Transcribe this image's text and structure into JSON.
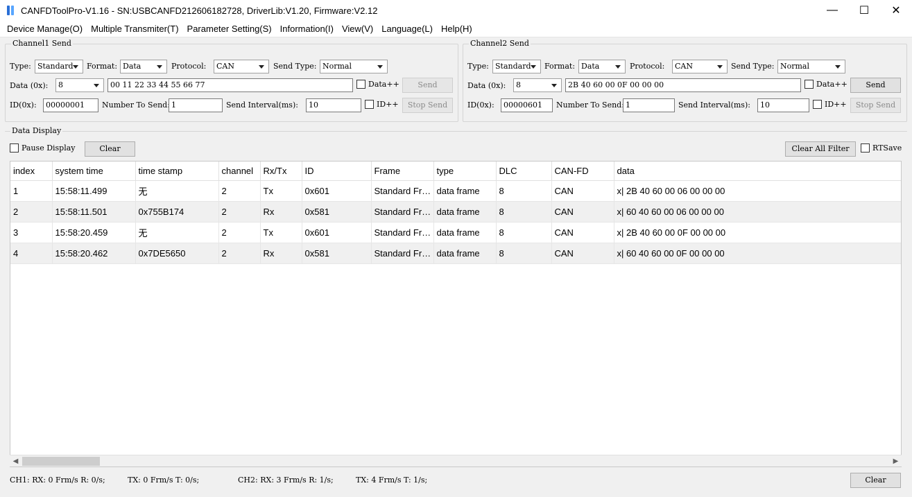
{
  "window": {
    "title": "CANFDToolPro-V1.16 - SN:USBCANFD212606182728, DriverLib:V1.20, Firmware:V2.12",
    "minimize": "—",
    "maximize": "☐",
    "close": "✕"
  },
  "menu": [
    "Device Manage(O)",
    "Multiple Transmiter(T)",
    "Parameter Setting(S)",
    "Information(I)",
    "View(V)",
    "Language(L)",
    "Help(H)"
  ],
  "ch1": {
    "title": "Channel1 Send",
    "type_label": "Type:",
    "type_value": "Standard",
    "format_label": "Format:",
    "format_value": "Data",
    "protocol_label": "Protocol:",
    "protocol_value": "CAN",
    "sendtype_label": "Send Type:",
    "sendtype_value": "Normal",
    "data_label": "Data (0x):",
    "dlc_value": "8",
    "data_value": "00 11 22 33 44 55 66 77",
    "dataplus_label": "Data++",
    "send_label": "Send",
    "id_label": "ID(0x):",
    "id_value": "00000001",
    "num_label": "Number To Send:",
    "num_value": "1",
    "interval_label": "Send Interval(ms):",
    "interval_value": "10",
    "idplus_label": "ID++",
    "stop_label": "Stop Send"
  },
  "ch2": {
    "title": "Channel2 Send",
    "type_label": "Type:",
    "type_value": "Standard",
    "format_label": "Format:",
    "format_value": "Data",
    "protocol_label": "Protocol:",
    "protocol_value": "CAN",
    "sendtype_label": "Send Type:",
    "sendtype_value": "Normal",
    "data_label": "Data (0x):",
    "dlc_value": "8",
    "data_value": "2B 40 60 00 0F 00 00 00",
    "dataplus_label": "Data++",
    "send_label": "Send",
    "id_label": "ID(0x):",
    "id_value": "00000601",
    "num_label": "Number To Send:",
    "num_value": "1",
    "interval_label": "Send Interval(ms):",
    "interval_value": "10",
    "idplus_label": "ID++",
    "stop_label": "Stop Send"
  },
  "display": {
    "title": "Data Display",
    "pause_label": "Pause Display",
    "clear_label": "Clear",
    "clear_filter_label": "Clear All Filter",
    "rtsave_label": "RTSave"
  },
  "table": {
    "columns": [
      "index",
      "system time",
      "time stamp",
      "channel",
      "Rx/Tx",
      "ID",
      "Frame",
      "type",
      "DLC",
      "CAN-FD",
      "data"
    ],
    "rows": [
      [
        "1",
        "15:58:11.499",
        "无",
        "2",
        "Tx",
        "0x601",
        "Standard Frame",
        "data frame",
        "8",
        "CAN",
        "x| 2B 40 60 00 06 00 00 00"
      ],
      [
        "2",
        "15:58:11.501",
        "0x755B174",
        "2",
        "Rx",
        "0x581",
        "Standard Frame",
        "data frame",
        "8",
        "CAN",
        "x| 60 40 60 00 06 00 00 00"
      ],
      [
        "3",
        "15:58:20.459",
        "无",
        "2",
        "Tx",
        "0x601",
        "Standard Frame",
        "data frame",
        "8",
        "CAN",
        "x| 2B 40 60 00 0F 00 00 00"
      ],
      [
        "4",
        "15:58:20.462",
        "0x7DE5650",
        "2",
        "Rx",
        "0x581",
        "Standard Frame",
        "data frame",
        "8",
        "CAN",
        "x| 60 40 60 00 0F 00 00 00"
      ]
    ]
  },
  "status": {
    "ch1_rx": "CH1: RX: 0 Frm/s R: 0/s;",
    "ch1_tx": "TX: 0 Frm/s T: 0/s;",
    "ch2_rx": "CH2: RX: 3 Frm/s R: 1/s;",
    "ch2_tx": "TX: 4 Frm/s T: 1/s;",
    "clear_label": "Clear"
  }
}
